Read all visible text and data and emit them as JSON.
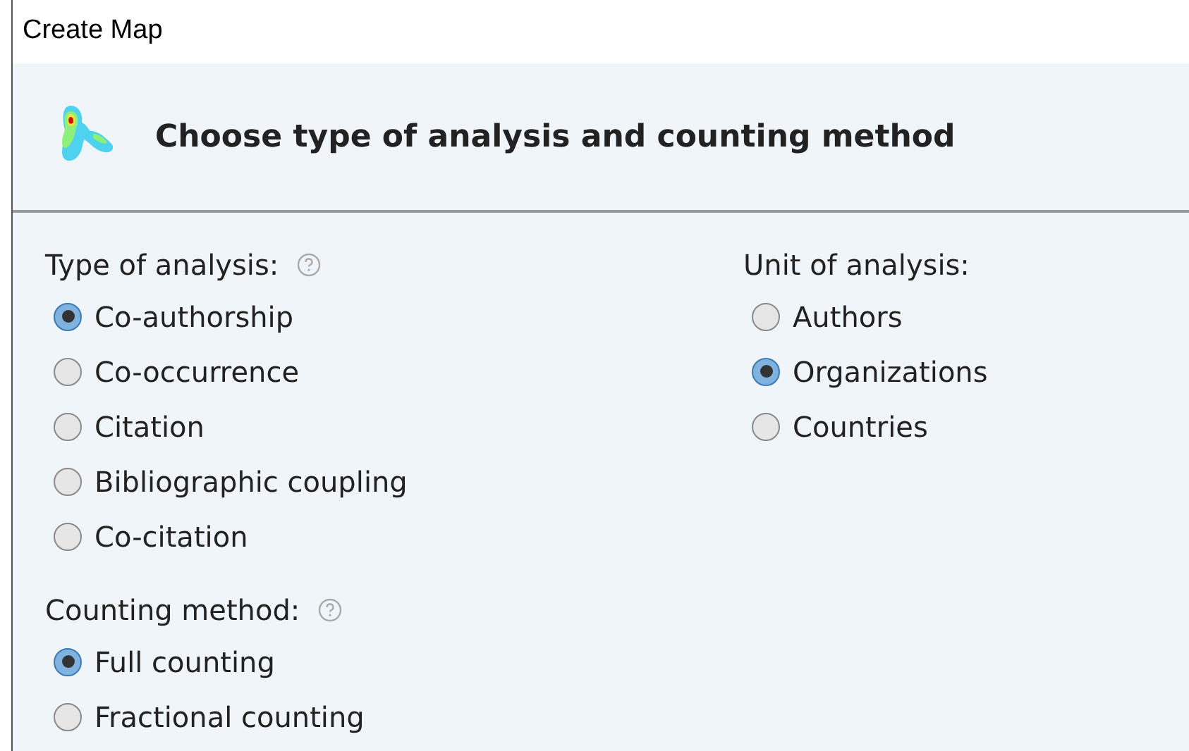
{
  "window": {
    "title": "Create Map"
  },
  "header": {
    "title": "Choose type of analysis and counting method"
  },
  "type_of_analysis": {
    "label": "Type of analysis:",
    "help": true,
    "options": [
      {
        "label": "Co-authorship",
        "selected": true
      },
      {
        "label": "Co-occurrence",
        "selected": false
      },
      {
        "label": "Citation",
        "selected": false
      },
      {
        "label": "Bibliographic coupling",
        "selected": false
      },
      {
        "label": "Co-citation",
        "selected": false
      }
    ]
  },
  "counting_method": {
    "label": "Counting method:",
    "help": true,
    "options": [
      {
        "label": "Full counting",
        "selected": true
      },
      {
        "label": "Fractional counting",
        "selected": false
      }
    ]
  },
  "unit_of_analysis": {
    "label": "Unit of analysis:",
    "help": false,
    "options": [
      {
        "label": "Authors",
        "selected": false
      },
      {
        "label": "Organizations",
        "selected": true
      },
      {
        "label": "Countries",
        "selected": false
      }
    ]
  }
}
